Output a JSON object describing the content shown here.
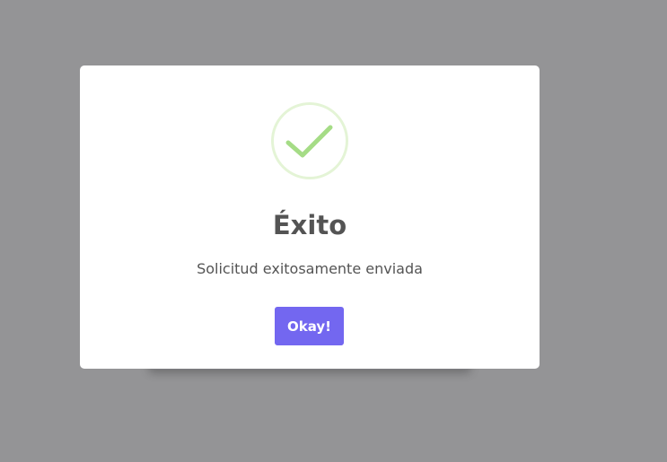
{
  "dialog": {
    "title": "Éxito",
    "message": "Solicitud exitosamente enviada",
    "confirm_label": "Okay!",
    "icon": "success-check-icon"
  },
  "colors": {
    "overlay": "#949496",
    "dialog_bg": "#ffffff",
    "text": "#545454",
    "confirm_button": "#7367f0",
    "success_ring": "#e4f4d6",
    "success_check": "#a5dc86"
  }
}
